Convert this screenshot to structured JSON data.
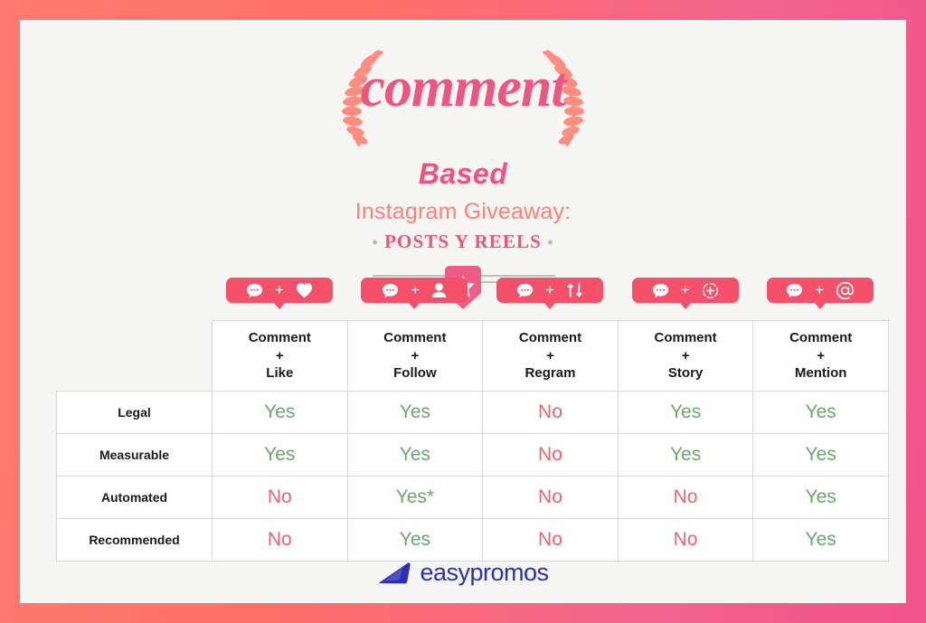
{
  "title": {
    "word_main": "comment",
    "word_sub": "Based",
    "line_giveaway": "Instagram Giveaway:",
    "line_posts": "POSTS Y REELS",
    "dot_left": "•",
    "dot_right": "•"
  },
  "badges": [
    {
      "name": "comment-like-badge",
      "left_icon": "comment-bubble-icon",
      "plus": "+",
      "right_icon": "heart-icon"
    },
    {
      "name": "comment-follow-badge",
      "left_icon": "comment-bubble-icon",
      "plus": "+",
      "right_icon": "person-icon"
    },
    {
      "name": "comment-regram-badge",
      "left_icon": "comment-bubble-icon",
      "plus": "+",
      "right_icon": "repost-icon"
    },
    {
      "name": "comment-story-badge",
      "left_icon": "comment-bubble-icon",
      "plus": "+",
      "right_icon": "story-add-icon"
    },
    {
      "name": "comment-mention-badge",
      "left_icon": "comment-bubble-icon",
      "plus": "+",
      "right_icon": "at-mention-icon"
    }
  ],
  "table": {
    "corner_label": "",
    "columns": [
      {
        "l1": "Comment",
        "l2": "+",
        "l3": "Like"
      },
      {
        "l1": "Comment",
        "l2": "+",
        "l3": "Follow"
      },
      {
        "l1": "Comment",
        "l2": "+",
        "l3": "Regram"
      },
      {
        "l1": "Comment",
        "l2": "+",
        "l3": "Story"
      },
      {
        "l1": "Comment",
        "l2": "+",
        "l3": "Mention"
      }
    ],
    "rows": [
      {
        "label": "Legal",
        "values": [
          "Yes",
          "Yes",
          "No",
          "Yes",
          "Yes"
        ]
      },
      {
        "label": "Measurable",
        "values": [
          "Yes",
          "Yes",
          "No",
          "Yes",
          "Yes"
        ]
      },
      {
        "label": "Automated",
        "values": [
          "No",
          "Yes*",
          "No",
          "No",
          "Yes"
        ]
      },
      {
        "label": "Recommended",
        "values": [
          "No",
          "Yes",
          "No",
          "No",
          "Yes"
        ]
      }
    ]
  },
  "footer": {
    "brand": "easypromos",
    "logo_icon": "easypromos-wing-mark"
  },
  "colors": {
    "border_gradient_start": "#FF7A70",
    "border_gradient_end": "#F1528A",
    "canvas_bg": "#F5F5F4",
    "badge_bg": "#F4506A",
    "title_pink": "#EE5680",
    "title_coral": "#FF8077",
    "yes_green": "#6AA86A",
    "no_red": "#F4606F",
    "brand_blue": "#2B2FB8",
    "grid_line": "#D8D8D8"
  }
}
